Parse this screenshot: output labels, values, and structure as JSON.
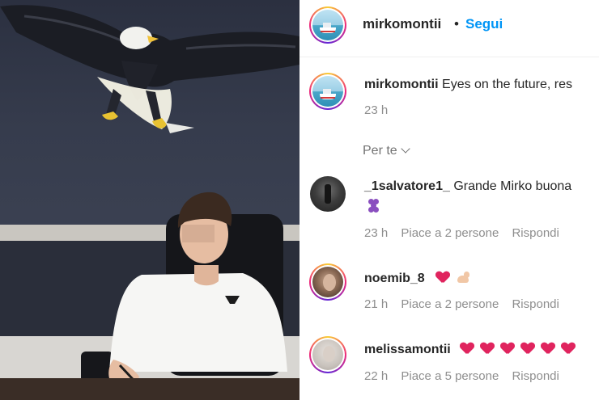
{
  "post": {
    "username": "mirkomontii",
    "separator": "•",
    "follow_label": "Segui",
    "caption_text": "Eyes on the future, res",
    "caption_time": "23 h",
    "see_translation": "Per te"
  },
  "comments": [
    {
      "username": "_1salvatore1_",
      "text": "Grande Mirko buona",
      "time": "23 h",
      "likes": "Piace a 2 persone",
      "reply": "Rispondi"
    },
    {
      "username": "noemib_8",
      "text": "",
      "time": "21 h",
      "likes": "Piace a 2 persone",
      "reply": "Rispondi"
    },
    {
      "username": "melissamontii",
      "text": "",
      "time": "22 h",
      "likes": "Piace a 5 persone",
      "reply": "Rispondi"
    }
  ],
  "icons": {
    "header_avatar": "boat-avatar-icon",
    "chevron": "chevron-down-icon",
    "heart": "red-heart-emoji",
    "grape": "grapes-emoji",
    "muscle": "flexed-biceps-emoji"
  },
  "colors": {
    "link_blue": "#0095f6",
    "meta_grey": "#8e8e8e",
    "heart_red": "#e0245e"
  }
}
